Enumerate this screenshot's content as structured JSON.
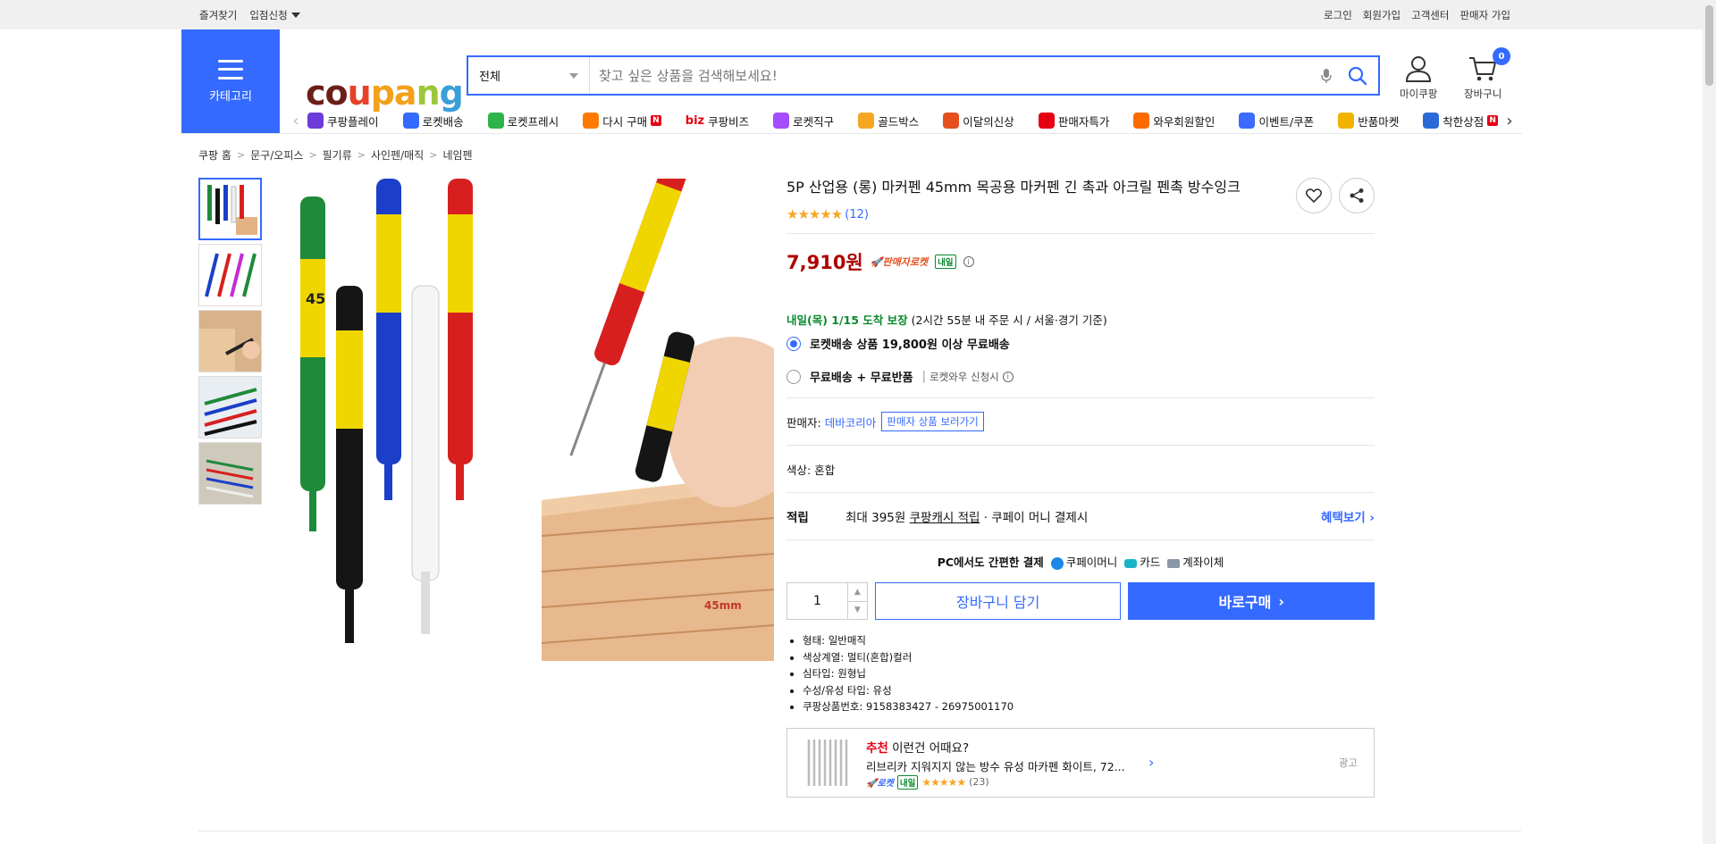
{
  "topbar": {
    "left": [
      "즐겨찾기",
      "입점신청"
    ],
    "right": [
      "로그인",
      "회원가입",
      "고객센터",
      "판매자 가입"
    ]
  },
  "category_btn": "카테고리",
  "logo": {
    "letters": [
      "c",
      "o",
      "u",
      "p",
      "a",
      "n",
      "g"
    ],
    "colors": [
      "#6b1f18",
      "#6b1f18",
      "#e7412a",
      "#f3a11b",
      "#f3a11b",
      "#9bc73a",
      "#3a9fd8"
    ]
  },
  "search": {
    "category": "전체",
    "placeholder": "찾고 싶은 상품을 검색해보세요!"
  },
  "header_icons": {
    "mypage": "마이쿠팡",
    "cart": "장바구니",
    "cart_count": "0"
  },
  "nav": [
    {
      "label": "쿠팡플레이",
      "color": "#6c3bd9"
    },
    {
      "label": "로켓배송",
      "color": "#346aff"
    },
    {
      "label": "로켓프레시",
      "color": "#2eb44a"
    },
    {
      "label": "다시 구매",
      "color": "#ff7a00",
      "badge": "N"
    },
    {
      "label": "쿠팡비즈",
      "color": "#e60012",
      "prefix": "biz"
    },
    {
      "label": "로켓직구",
      "color": "#a34dff"
    },
    {
      "label": "골드박스",
      "color": "#f5a623"
    },
    {
      "label": "이달의신상",
      "color": "#e5501e"
    },
    {
      "label": "판매자특가",
      "color": "#e60012"
    },
    {
      "label": "와우회원할인",
      "color": "#ff6a00"
    },
    {
      "label": "이벤트/쿠폰",
      "color": "#3d6bff"
    },
    {
      "label": "반품마켓",
      "color": "#f0b400"
    },
    {
      "label": "착한상점",
      "color": "#2b6ad6",
      "badge": "N"
    }
  ],
  "breadcrumb": [
    "쿠팡 홈",
    "문구/오피스",
    "필기류",
    "사인펜/매직",
    "네임펜"
  ],
  "product": {
    "title": "5P 산업용 (롱) 마커펜 45mm 목공용 마커펜 긴 촉과 아크릴 펜촉 방수잉크",
    "review_count": "(12)",
    "rating": 5,
    "price": "7,910원",
    "seller_rocket": "판매자로켓",
    "tomorrow": "내일",
    "delivery_head": "내일(목) 1/15 도착 보장",
    "delivery_tail": "(2시간 55분 내 주문 시 / 서울·경기 기준)",
    "ship_option1": "로켓배송 상품 19,800원 이상 무료배송",
    "ship_option2": "무료배송 + 무료반품",
    "ship_option2_sub": "로켓와우 신청시",
    "seller_label": "판매자:",
    "seller_name": "데바코리아",
    "seller_btn": "판매자 상품 보러가기",
    "color_label": "색상:",
    "color_value": "혼합",
    "benefit_label": "적립",
    "benefit_text_1": "최대 395원",
    "benefit_text_2": "쿠팡캐시 적립",
    "benefit_text_3": "· 쿠페이 머니 결제시",
    "benefit_more": "혜택보기",
    "pay_title": "PC에서도 간편한 결제",
    "pay_methods": [
      "쿠페이머니",
      "카드",
      "계좌이체"
    ],
    "qty": "1",
    "cart_btn": "장바구니 담기",
    "buy_btn": "바로구매",
    "specs": [
      "형태: 일반매직",
      "색상계열: 멀티(혼합)컬러",
      "심타입: 원형닙",
      "수성/유성 타입: 유성",
      "쿠팡상품번호: 9158383427 - 26975001170"
    ]
  },
  "reco": {
    "red": "추천",
    "title": "이런건 어때요?",
    "name": "리브리카 지워지지 않는 방수 유성 마카펜 화이트, 72...",
    "rocket": "로켓",
    "tomorrow": "내일",
    "review_count": "(23)",
    "rating": 4.5,
    "ad": "광고"
  },
  "image": {
    "size_label": "45mm",
    "pen_label": "45"
  }
}
